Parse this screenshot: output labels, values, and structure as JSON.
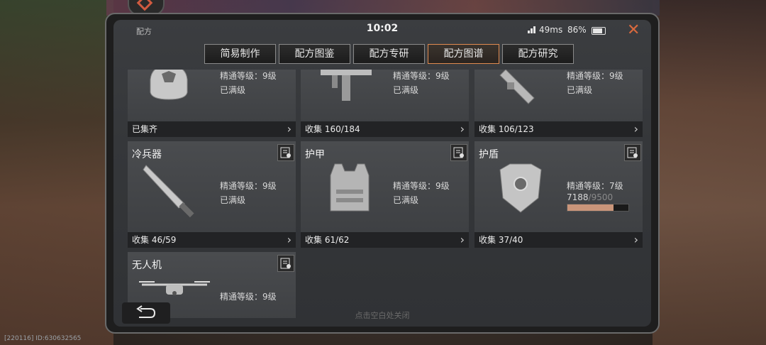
{
  "window": {
    "title": "配方",
    "time": "10:02",
    "ping": "49ms",
    "battery": "86%"
  },
  "tabs": [
    {
      "label": "简易制作"
    },
    {
      "label": "配方图鉴"
    },
    {
      "label": "配方专研"
    },
    {
      "label": "配方图谱",
      "active": true
    },
    {
      "label": "配方研究"
    }
  ],
  "cards": {
    "helmet": {
      "level": "精通等级：9级",
      "status": "已满级",
      "footer": "已集齐"
    },
    "smg": {
      "level": "精通等级：9级",
      "status": "已满级",
      "footer": "收集 160/184"
    },
    "launcher": {
      "level": "精通等级：9级",
      "status": "已满级",
      "footer": "收集 106/123"
    },
    "melee": {
      "name": "冷兵器",
      "level": "精通等级：9级",
      "status": "已满级",
      "footer": "收集 46/59"
    },
    "armor": {
      "name": "护甲",
      "level": "精通等级：9级",
      "status": "已满级",
      "footer": "收集 61/62"
    },
    "shield": {
      "name": "护盾",
      "level": "精通等级：7级",
      "progress_current": "7188",
      "progress_max": "/9500",
      "progress_fraction": 0.757,
      "footer": "收集 37/40"
    },
    "drone": {
      "name": "无人机",
      "level": "精通等级：9级"
    }
  },
  "hint": "点击空白处关闭",
  "footer_id": "[220116] ID:630632565",
  "icons": [
    "signal-icon",
    "battery-icon",
    "close-icon",
    "blueprint-icon",
    "chevron-right-icon",
    "back-icon"
  ],
  "colors": {
    "accent": "#e08a50",
    "progress": "#c9957a"
  }
}
